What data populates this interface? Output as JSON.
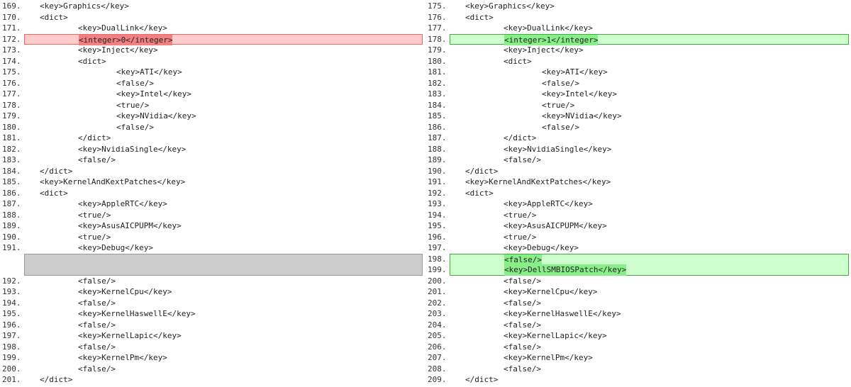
{
  "left": [
    {
      "n": "169.",
      "i": 2,
      "t": "<key>Graphics</key>"
    },
    {
      "n": "170.",
      "i": 2,
      "t": "<dict>"
    },
    {
      "n": "171.",
      "i": 3,
      "t": "<key>DualLink</key>"
    },
    {
      "n": "172.",
      "i": 3,
      "t": "<integer>0</integer>",
      "s": "removed"
    },
    {
      "n": "173.",
      "i": 3,
      "t": "<key>Inject</key>"
    },
    {
      "n": "174.",
      "i": 3,
      "t": "<dict>"
    },
    {
      "n": "175.",
      "i": 4,
      "t": "<key>ATI</key>"
    },
    {
      "n": "176.",
      "i": 4,
      "t": "<false/>"
    },
    {
      "n": "177.",
      "i": 4,
      "t": "<key>Intel</key>"
    },
    {
      "n": "178.",
      "i": 4,
      "t": "<true/>"
    },
    {
      "n": "179.",
      "i": 4,
      "t": "<key>NVidia</key>"
    },
    {
      "n": "180.",
      "i": 4,
      "t": "<false/>"
    },
    {
      "n": "181.",
      "i": 3,
      "t": "</dict>"
    },
    {
      "n": "182.",
      "i": 3,
      "t": "<key>NvidiaSingle</key>"
    },
    {
      "n": "183.",
      "i": 3,
      "t": "<false/>"
    },
    {
      "n": "184.",
      "i": 2,
      "t": "</dict>"
    },
    {
      "n": "185.",
      "i": 2,
      "t": "<key>KernelAndKextPatches</key>"
    },
    {
      "n": "186.",
      "i": 2,
      "t": "<dict>"
    },
    {
      "n": "187.",
      "i": 3,
      "t": "<key>AppleRTC</key>"
    },
    {
      "n": "188.",
      "i": 3,
      "t": "<true/>"
    },
    {
      "n": "189.",
      "i": 3,
      "t": "<key>AsusAICPUPM</key>"
    },
    {
      "n": "190.",
      "i": 3,
      "t": "<true/>"
    },
    {
      "n": "191.",
      "i": 3,
      "t": "<key>Debug</key>"
    },
    {
      "n": "",
      "i": 0,
      "t": "",
      "s": "filler",
      "p": "first"
    },
    {
      "n": "",
      "i": 0,
      "t": "",
      "s": "filler",
      "p": "last"
    },
    {
      "n": "192.",
      "i": 3,
      "t": "<false/>"
    },
    {
      "n": "193.",
      "i": 3,
      "t": "<key>KernelCpu</key>"
    },
    {
      "n": "194.",
      "i": 3,
      "t": "<false/>"
    },
    {
      "n": "195.",
      "i": 3,
      "t": "<key>KernelHaswellE</key>"
    },
    {
      "n": "196.",
      "i": 3,
      "t": "<false/>"
    },
    {
      "n": "197.",
      "i": 3,
      "t": "<key>KernelLapic</key>"
    },
    {
      "n": "198.",
      "i": 3,
      "t": "<false/>"
    },
    {
      "n": "199.",
      "i": 3,
      "t": "<key>KernelPm</key>"
    },
    {
      "n": "200.",
      "i": 3,
      "t": "<false/>"
    },
    {
      "n": "201.",
      "i": 2,
      "t": "</dict>"
    }
  ],
  "right": [
    {
      "n": "175.",
      "i": 2,
      "t": "<key>Graphics</key>"
    },
    {
      "n": "176.",
      "i": 2,
      "t": "<dict>"
    },
    {
      "n": "177.",
      "i": 3,
      "t": "<key>DualLink</key>"
    },
    {
      "n": "178.",
      "i": 3,
      "t": "<integer>1</integer>",
      "s": "added",
      "p": "first last"
    },
    {
      "n": "179.",
      "i": 3,
      "t": "<key>Inject</key>"
    },
    {
      "n": "180.",
      "i": 3,
      "t": "<dict>"
    },
    {
      "n": "181.",
      "i": 4,
      "t": "<key>ATI</key>"
    },
    {
      "n": "182.",
      "i": 4,
      "t": "<false/>"
    },
    {
      "n": "183.",
      "i": 4,
      "t": "<key>Intel</key>"
    },
    {
      "n": "184.",
      "i": 4,
      "t": "<true/>"
    },
    {
      "n": "185.",
      "i": 4,
      "t": "<key>NVidia</key>"
    },
    {
      "n": "186.",
      "i": 4,
      "t": "<false/>"
    },
    {
      "n": "187.",
      "i": 3,
      "t": "</dict>"
    },
    {
      "n": "188.",
      "i": 3,
      "t": "<key>NvidiaSingle</key>"
    },
    {
      "n": "189.",
      "i": 3,
      "t": "<false/>"
    },
    {
      "n": "190.",
      "i": 2,
      "t": "</dict>"
    },
    {
      "n": "191.",
      "i": 2,
      "t": "<key>KernelAndKextPatches</key>"
    },
    {
      "n": "192.",
      "i": 2,
      "t": "<dict>"
    },
    {
      "n": "193.",
      "i": 3,
      "t": "<key>AppleRTC</key>"
    },
    {
      "n": "194.",
      "i": 3,
      "t": "<true/>"
    },
    {
      "n": "195.",
      "i": 3,
      "t": "<key>AsusAICPUPM</key>"
    },
    {
      "n": "196.",
      "i": 3,
      "t": "<true/>"
    },
    {
      "n": "197.",
      "i": 3,
      "t": "<key>Debug</key>"
    },
    {
      "n": "198.",
      "i": 3,
      "t": "<false/>",
      "s": "added",
      "p": "first"
    },
    {
      "n": "199.",
      "i": 3,
      "t": "<key>DellSMBIOSPatch</key>",
      "s": "added",
      "p": "last"
    },
    {
      "n": "200.",
      "i": 3,
      "t": "<false/>"
    },
    {
      "n": "201.",
      "i": 3,
      "t": "<key>KernelCpu</key>"
    },
    {
      "n": "202.",
      "i": 3,
      "t": "<false/>"
    },
    {
      "n": "203.",
      "i": 3,
      "t": "<key>KernelHaswellE</key>"
    },
    {
      "n": "204.",
      "i": 3,
      "t": "<false/>"
    },
    {
      "n": "205.",
      "i": 3,
      "t": "<key>KernelLapic</key>"
    },
    {
      "n": "206.",
      "i": 3,
      "t": "<false/>"
    },
    {
      "n": "207.",
      "i": 3,
      "t": "<key>KernelPm</key>"
    },
    {
      "n": "208.",
      "i": 3,
      "t": "<false/>"
    },
    {
      "n": "209.",
      "i": 2,
      "t": "</dict>"
    }
  ],
  "colors": {
    "removed": "#ffcccc",
    "removed_hl": "#f28080",
    "added": "#ccffcc",
    "added_hl": "#88ee88",
    "filler": "#cccccc"
  }
}
